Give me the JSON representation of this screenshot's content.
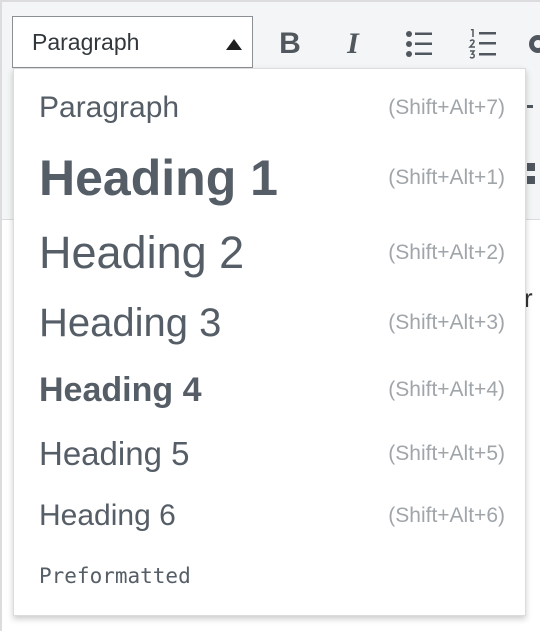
{
  "toolbar": {
    "format_select": {
      "value": "Paragraph"
    },
    "buttons": [
      {
        "name": "bold",
        "glyph": "B"
      },
      {
        "name": "italic",
        "glyph": "I"
      },
      {
        "name": "bulleted-list",
        "icon": "bulleted-list-icon"
      },
      {
        "name": "numbered-list",
        "icon": "numbered-list-icon"
      },
      {
        "name": "quote",
        "icon": "quote-icon"
      }
    ]
  },
  "dropdown": {
    "items": [
      {
        "label": "Paragraph",
        "shortcut": "(Shift+Alt+7)"
      },
      {
        "label": "Heading 1",
        "shortcut": "(Shift+Alt+1)"
      },
      {
        "label": "Heading 2",
        "shortcut": "(Shift+Alt+2)"
      },
      {
        "label": "Heading 3",
        "shortcut": "(Shift+Alt+3)"
      },
      {
        "label": "Heading 4",
        "shortcut": "(Shift+Alt+4)"
      },
      {
        "label": "Heading 5",
        "shortcut": "(Shift+Alt+5)"
      },
      {
        "label": "Heading 6",
        "shortcut": "(Shift+Alt+6)"
      },
      {
        "label": "Preformatted",
        "shortcut": ""
      }
    ]
  },
  "editor": {
    "visible_text_fragment": "r"
  },
  "colors": {
    "toolbar_bg": "#f3f5f6",
    "icon": "#50575e",
    "menu_text": "#555d66",
    "shortcut_text": "#a0a5aa",
    "border": "#dcdcde"
  }
}
